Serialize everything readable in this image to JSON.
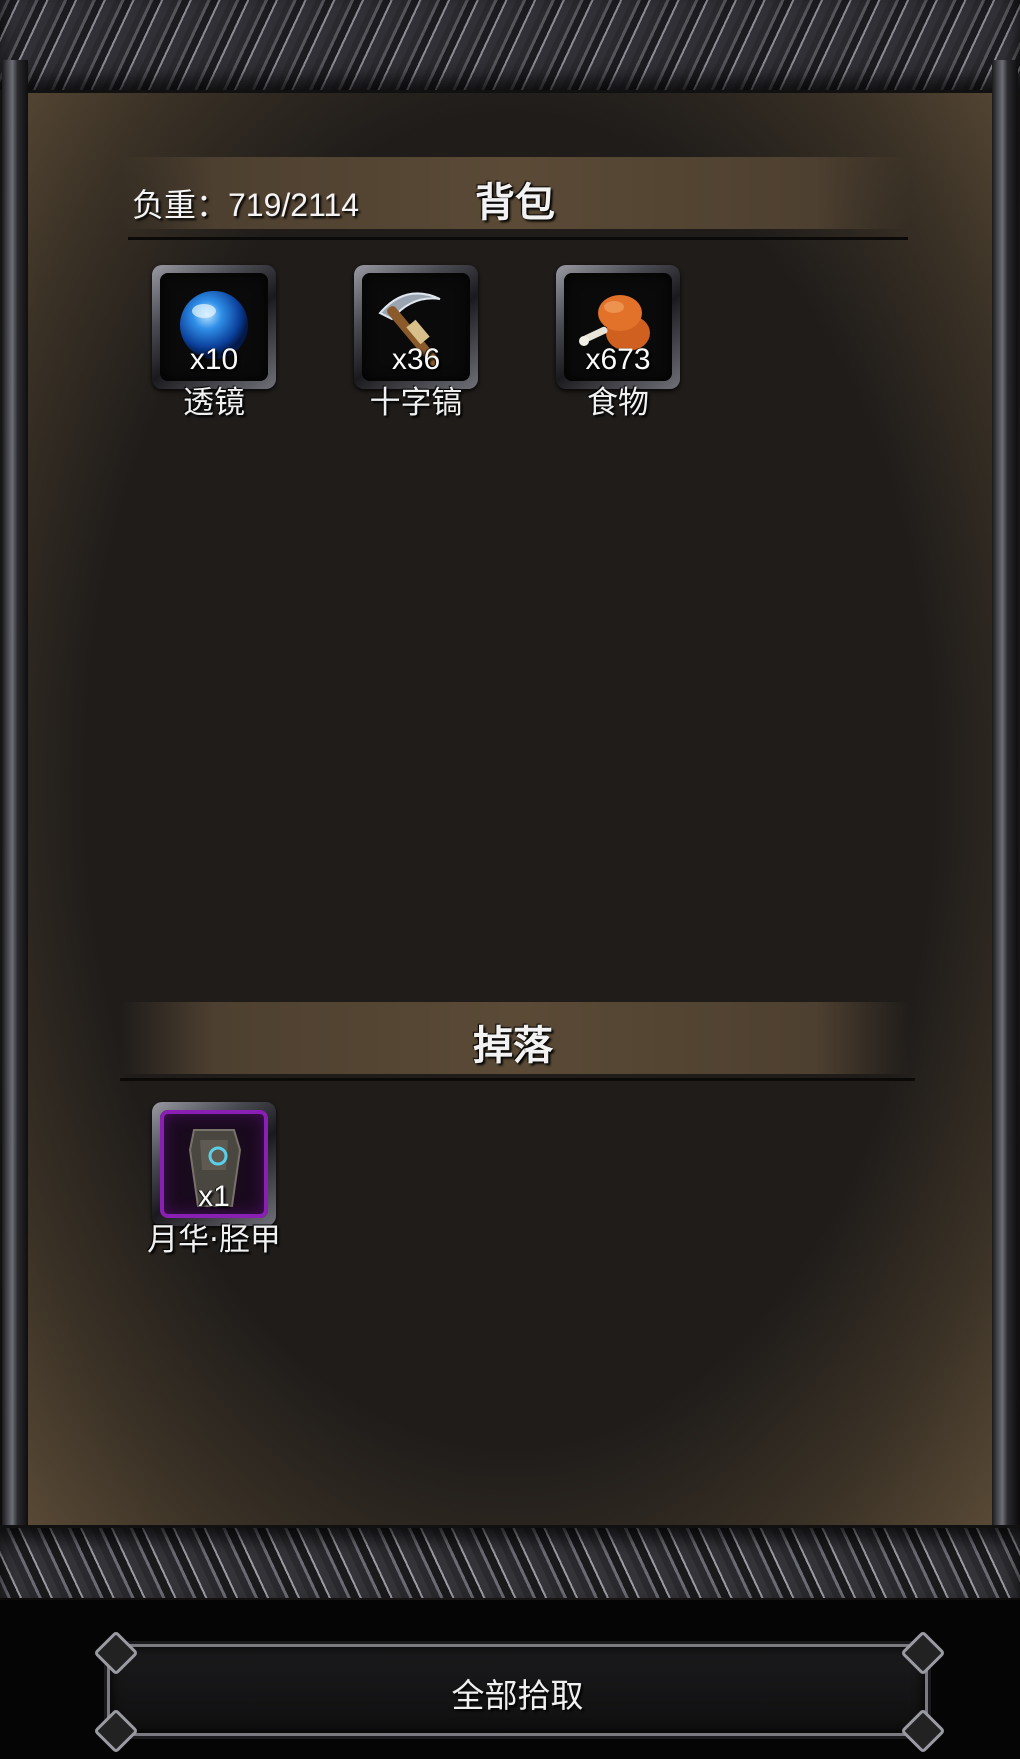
{
  "inventory": {
    "weight_label": "负重：719/2114",
    "title": "背包",
    "items": [
      {
        "name": "透镜",
        "count": "x10",
        "icon": "lens-icon"
      },
      {
        "name": "十字镐",
        "count": "x36",
        "icon": "pickaxe-icon"
      },
      {
        "name": "食物",
        "count": "x673",
        "icon": "meat-icon"
      }
    ]
  },
  "drops": {
    "title": "掉落",
    "items": [
      {
        "name": "月华·胫甲",
        "count": "x1",
        "icon": "greaves-icon",
        "rarity_color": "#8a1fb4"
      }
    ]
  },
  "pickup_button": {
    "label": "全部拾取"
  }
}
